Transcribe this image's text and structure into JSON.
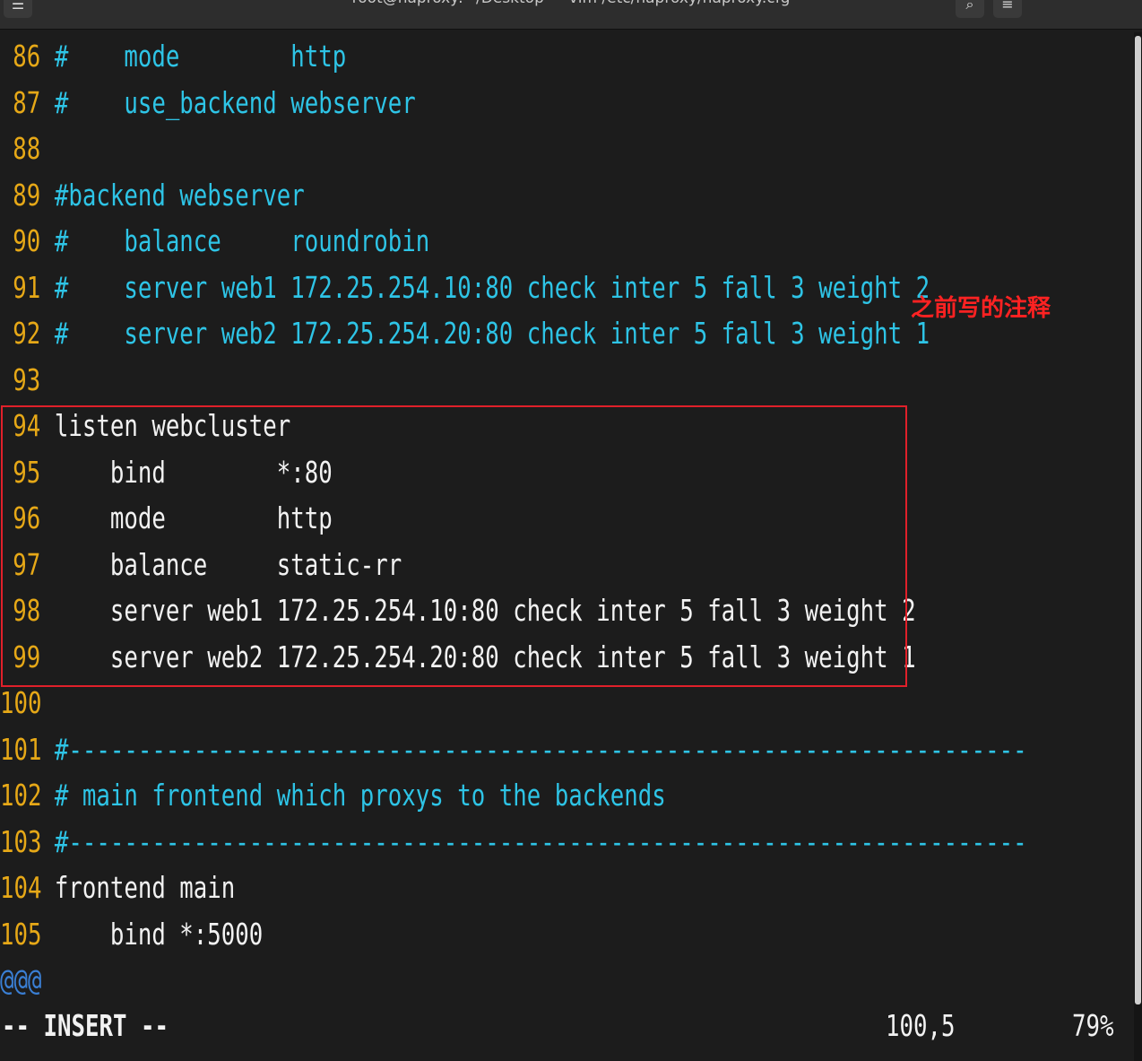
{
  "window": {
    "title": "root@haproxy:~/Desktop — vim /etc/haproxy/haproxy.cfg",
    "menu_icon": "terminal-menu-icon",
    "search_icon": "search-icon",
    "hamburger_icon": "hamburger-menu-icon"
  },
  "editor": {
    "lines": [
      {
        "num": "86",
        "text": "#    mode        http",
        "type": "comment"
      },
      {
        "num": "87",
        "text": "#    use_backend webserver",
        "type": "comment"
      },
      {
        "num": "88",
        "text": "",
        "type": "code"
      },
      {
        "num": "89",
        "text": "#backend webserver",
        "type": "comment"
      },
      {
        "num": "90",
        "text": "#    balance     roundrobin",
        "type": "comment"
      },
      {
        "num": "91",
        "text": "#    server web1 172.25.254.10:80 check inter 5 fall 3 weight 2",
        "type": "comment"
      },
      {
        "num": "92",
        "text": "#    server web2 172.25.254.20:80 check inter 5 fall 3 weight 1",
        "type": "comment"
      },
      {
        "num": "93",
        "text": "",
        "type": "code"
      },
      {
        "num": "94",
        "text": "listen webcluster",
        "type": "code"
      },
      {
        "num": "95",
        "text": "    bind        *:80",
        "type": "code"
      },
      {
        "num": "96",
        "text": "    mode        http",
        "type": "code"
      },
      {
        "num": "97",
        "text": "    balance     static-rr",
        "type": "code"
      },
      {
        "num": "98",
        "text": "    server web1 172.25.254.10:80 check inter 5 fall 3 weight 2",
        "type": "code"
      },
      {
        "num": "99",
        "text": "    server web2 172.25.254.20:80 check inter 5 fall 3 weight 1",
        "type": "code"
      },
      {
        "num": "100",
        "text": "",
        "type": "code"
      },
      {
        "num": "101",
        "text": "#---------------------------------------------------------------------",
        "type": "comment"
      },
      {
        "num": "102",
        "text": "# main frontend which proxys to the backends",
        "type": "comment"
      },
      {
        "num": "103",
        "text": "#---------------------------------------------------------------------",
        "type": "comment"
      },
      {
        "num": "104",
        "text": "frontend main",
        "type": "code"
      },
      {
        "num": "105",
        "text": "    bind *:5000",
        "type": "code"
      }
    ],
    "overflow_marker": "@@@"
  },
  "statusline": {
    "mode": "-- INSERT --",
    "position": "100,5",
    "percent": "79%"
  },
  "annotation": {
    "text": "之前写的注释"
  },
  "colors": {
    "background": "#1c1c1c",
    "line_number": "#e6a817",
    "comment": "#2ec4e6",
    "code": "#f2f2f2",
    "highlight_box": "#e0202a",
    "annotation": "#ff2222"
  }
}
